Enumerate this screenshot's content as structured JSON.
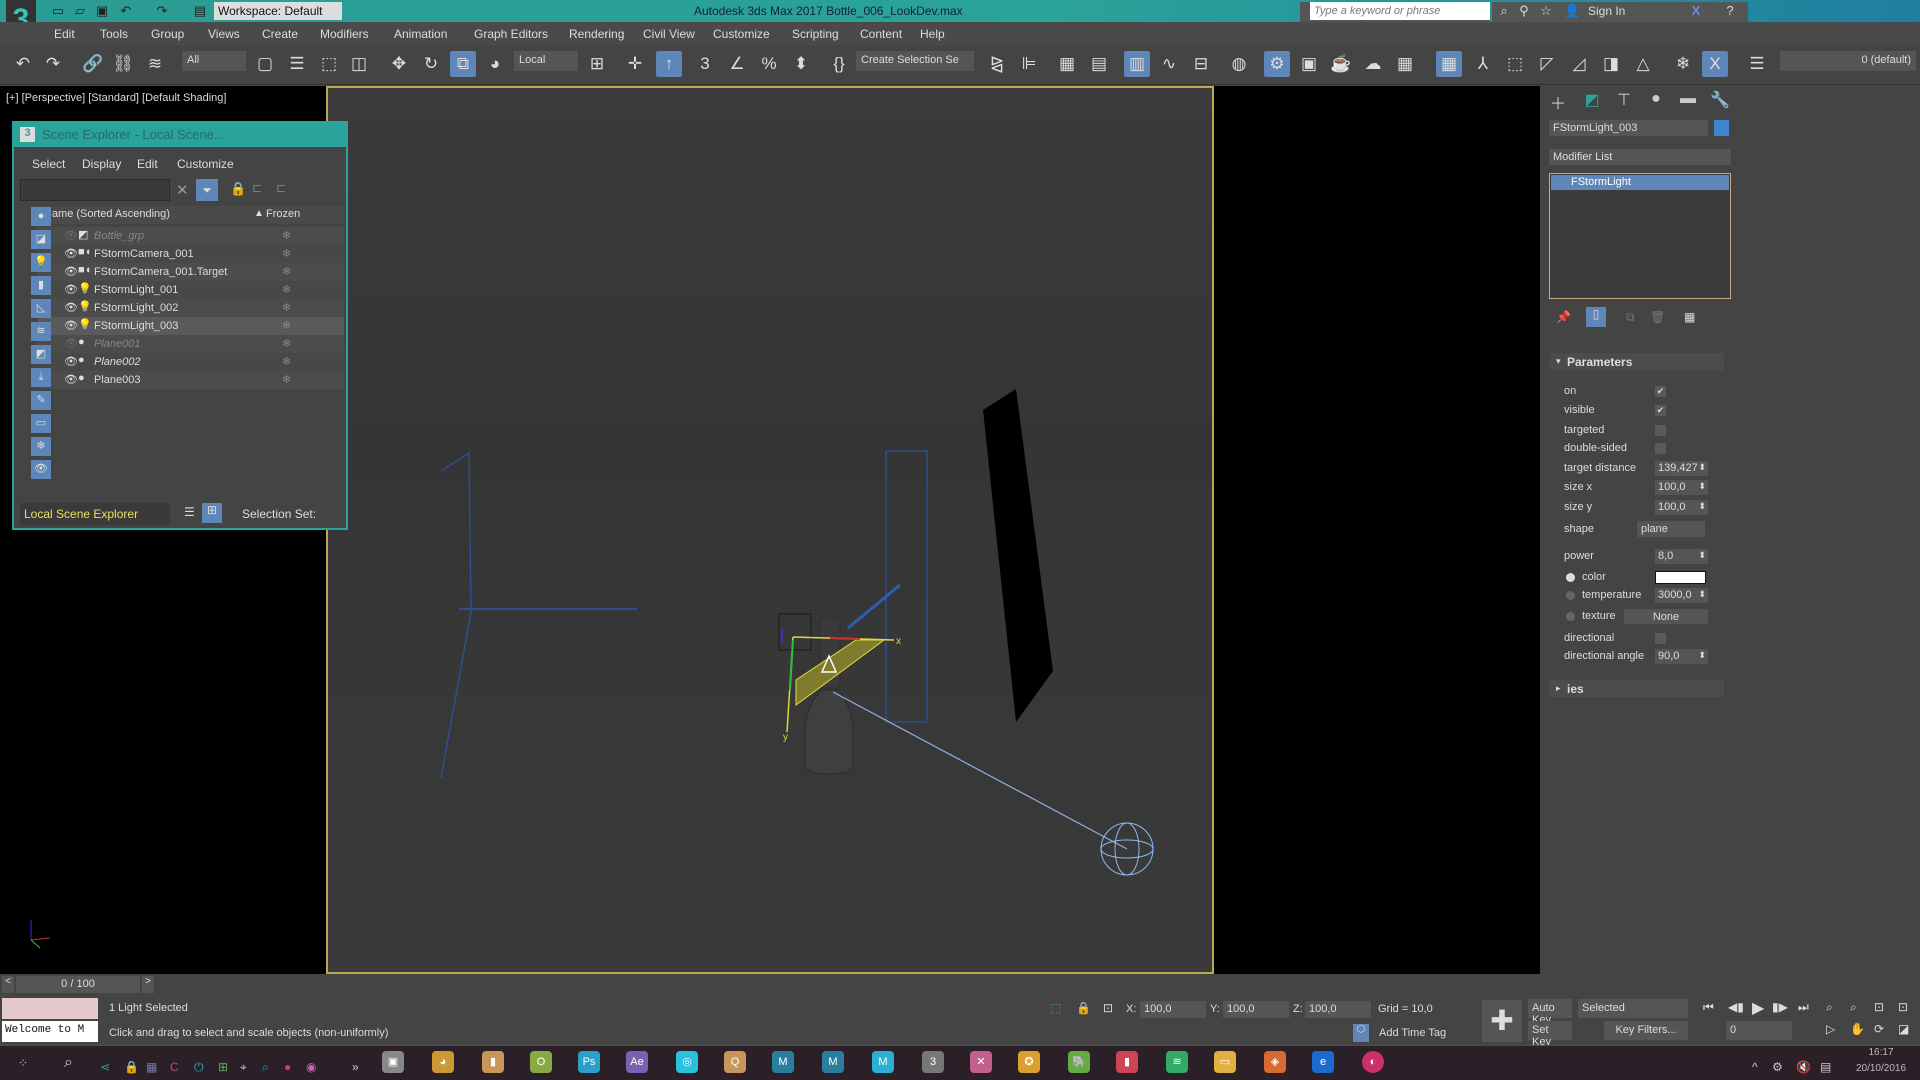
{
  "titlebar": {
    "app_title": "Autodesk 3ds Max 2017    Bottle_006_LookDev.max",
    "workspace": "Workspace: Default",
    "search_placeholder": "Type a keyword or phrase",
    "sign_in": "Sign In",
    "logo": "3"
  },
  "menubar": [
    "Edit",
    "Tools",
    "Group",
    "Views",
    "Create",
    "Modifiers",
    "Animation",
    "Graph Editors",
    "Rendering",
    "Civil View",
    "Customize",
    "Scripting",
    "Content",
    "Help"
  ],
  "toolbar": {
    "selection_filter": "All",
    "reference_coord": "Local",
    "named_selection": "Create Selection Se",
    "layer": "0 (default)"
  },
  "viewport": {
    "label": "[+] [Perspective] [Standard] [Default Shading]",
    "gizmo_x": "x",
    "gizmo_y": "y"
  },
  "scene_explorer": {
    "title": "Scene Explorer - Local Scene...",
    "menu": [
      "Select",
      "Display",
      "Edit",
      "Customize"
    ],
    "col_name": "Name (Sorted Ascending)",
    "col_frozen": "Frozen",
    "rows": [
      {
        "name": "Bottle_grp",
        "icon": "group-icon",
        "hidden": true,
        "selected": false
      },
      {
        "name": "FStormCamera_001",
        "icon": "camera-icon",
        "hidden": false,
        "selected": false
      },
      {
        "name": "FStormCamera_001.Target",
        "icon": "camera-icon",
        "hidden": false,
        "selected": false
      },
      {
        "name": "FStormLight_001",
        "icon": "light-icon",
        "hidden": false,
        "selected": false
      },
      {
        "name": "FStormLight_002",
        "icon": "light-icon",
        "hidden": false,
        "selected": false
      },
      {
        "name": "FStormLight_003",
        "icon": "light-icon",
        "hidden": false,
        "selected": true
      },
      {
        "name": "Plane001",
        "icon": "geometry-icon",
        "hidden": true,
        "selected": false
      },
      {
        "name": "Plane002",
        "icon": "geometry-icon",
        "hidden": false,
        "selected": false
      },
      {
        "name": "Plane003",
        "icon": "geometry-icon",
        "hidden": false,
        "selected": false
      }
    ],
    "explorer_name": "Local Scene Explorer",
    "selection_set": "Selection Set:"
  },
  "command_panel": {
    "object_name": "FStormLight_003",
    "object_color": "#3a86d0",
    "modifier_list": "Modifier List",
    "stack_item": "FStormLight",
    "parameters_title": "Parameters",
    "ies_title": "ies",
    "params": {
      "on": "on",
      "visible": "visible",
      "targeted": "targeted",
      "double_sided": "double-sided",
      "target_distance": "target distance",
      "target_distance_val": "139,427",
      "size_x": "size x",
      "size_x_val": "100,0",
      "size_y": "size y",
      "size_y_val": "100,0",
      "shape": "shape",
      "shape_val": "plane",
      "power": "power",
      "power_val": "8,0",
      "color": "color",
      "temperature": "temperature",
      "temperature_val": "3000,0",
      "texture": "texture",
      "texture_val": "None",
      "directional": "directional",
      "directional_angle": "directional angle",
      "directional_angle_val": "90,0"
    },
    "checks": {
      "on": true,
      "visible": true,
      "targeted": false,
      "double_sided": false,
      "directional": false
    }
  },
  "status": {
    "time": "0 / 100",
    "selected": "1 Light Selected",
    "prompt": "Click and drag to select and scale objects (non-uniformly)",
    "listener": "Welcome to M",
    "x_label": "X:",
    "x": "100,0",
    "y_label": "Y:",
    "y": "100,0",
    "z_label": "Z:",
    "z": "100,0",
    "grid": "Grid = 10,0",
    "add_time_tag": "Add Time Tag",
    "auto_key": "Auto Key",
    "set_key": "Set Key",
    "key_mode": "Selected",
    "key_filters": "Key Filters...",
    "frame": "0"
  },
  "taskbar": {
    "time": "16:17",
    "date": "20/10/2016"
  },
  "colors": {
    "accent": "#2aa39a",
    "selection": "#5f86b8",
    "viewport_border": "#b8a94a"
  }
}
